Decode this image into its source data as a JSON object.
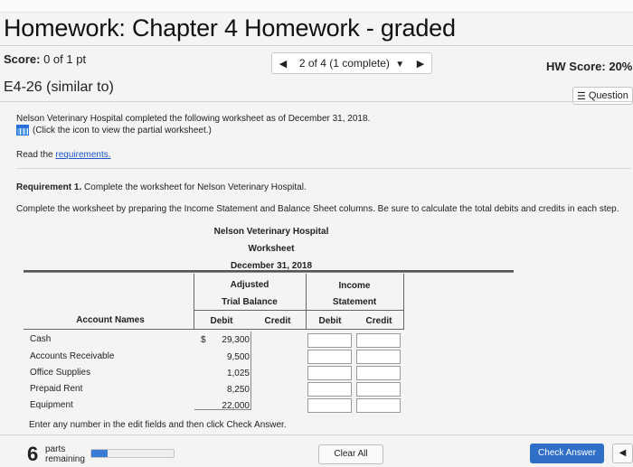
{
  "header": {
    "title": "Homework: Chapter 4 Homework - graded",
    "score_label": "Score:",
    "score_value": "0 of 1 pt",
    "nav_label": "2 of 4 (1 complete)",
    "hw_score": "HW Score: 20%,",
    "problem_id": "E4-26 (similar to)",
    "question_button": "Question"
  },
  "intro": {
    "line1": "Nelson Veterinary Hospital completed the following worksheet as of December 31, 2018.",
    "line2": "(Click the icon to view the partial worksheet.)",
    "read_prefix": "Read the",
    "read_link": "requirements."
  },
  "requirement": {
    "label": "Requirement 1.",
    "text": "Complete the worksheet for Nelson Veterinary Hospital.",
    "instruction": "Complete the worksheet by preparing the Income Statement and Balance Sheet columns. Be sure to calculate the total debits and credits in each step."
  },
  "worksheet": {
    "company": "Nelson Veterinary Hospital",
    "name": "Worksheet",
    "date": "December 31, 2018",
    "adjusted_line1": "Adjusted",
    "adjusted_line2": "Trial Balance",
    "income_line1": "Income",
    "income_line2": "Statement",
    "col_account": "Account Names",
    "col_debit": "Debit",
    "col_credit": "Credit",
    "col_is_debit": "Debit",
    "col_is_credit": "Credit",
    "currency": "$",
    "rows": [
      {
        "account": "Cash",
        "debit": "29,300"
      },
      {
        "account": "Accounts Receivable",
        "debit": "9,500"
      },
      {
        "account": "Office Supplies",
        "debit": "1,025"
      },
      {
        "account": "Prepaid Rent",
        "debit": "8,250"
      },
      {
        "account": "Equipment",
        "debit": "22,000"
      }
    ]
  },
  "footer": {
    "instruction": "Enter any number in the edit fields and then click Check Answer.",
    "parts_count": "6",
    "parts_label_1": "parts",
    "parts_label_2": "remaining",
    "progress": 0.2,
    "clear_all": "Clear All",
    "check_answer": "Check Answer"
  }
}
